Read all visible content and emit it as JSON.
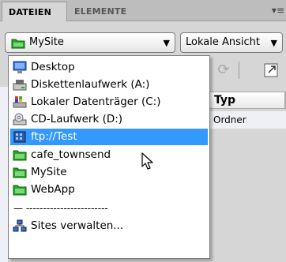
{
  "tabs": [
    {
      "label": "DATEIEN",
      "active": true
    },
    {
      "label": "ELEMENTE",
      "active": false
    }
  ],
  "panel_menu_icon": "panel-options-icon",
  "site_select": {
    "value": "MySite",
    "icon": "site-folder-icon"
  },
  "view_select": {
    "value": "Lokale Ansicht"
  },
  "table": {
    "column_type": "Typ",
    "row_type": "Ordner"
  },
  "dropdown": {
    "items": [
      {
        "label": "Desktop",
        "icon": "desktop-icon"
      },
      {
        "label": "Diskettenlaufwerk (A:)",
        "icon": "floppy-drive-icon"
      },
      {
        "label": "Lokaler Datenträger (C:)",
        "icon": "hard-drive-icon"
      },
      {
        "label": "CD-Laufwerk (D:)",
        "icon": "cd-drive-icon"
      },
      {
        "label": "ftp://Test",
        "icon": "ftp-server-icon",
        "selected": true
      },
      {
        "label": "cafe_townsend",
        "icon": "site-folder-icon"
      },
      {
        "label": "MySite",
        "icon": "site-folder-icon"
      },
      {
        "label": "WebApp",
        "icon": "site-folder-icon"
      }
    ],
    "separator": "— ------------------------",
    "manage": {
      "label": "Sites verwalten...",
      "icon": "manage-sites-icon"
    }
  },
  "colors": {
    "selection": "#3399ff",
    "folder": "#22aa22",
    "panel_bg": "#d6d6d6"
  }
}
